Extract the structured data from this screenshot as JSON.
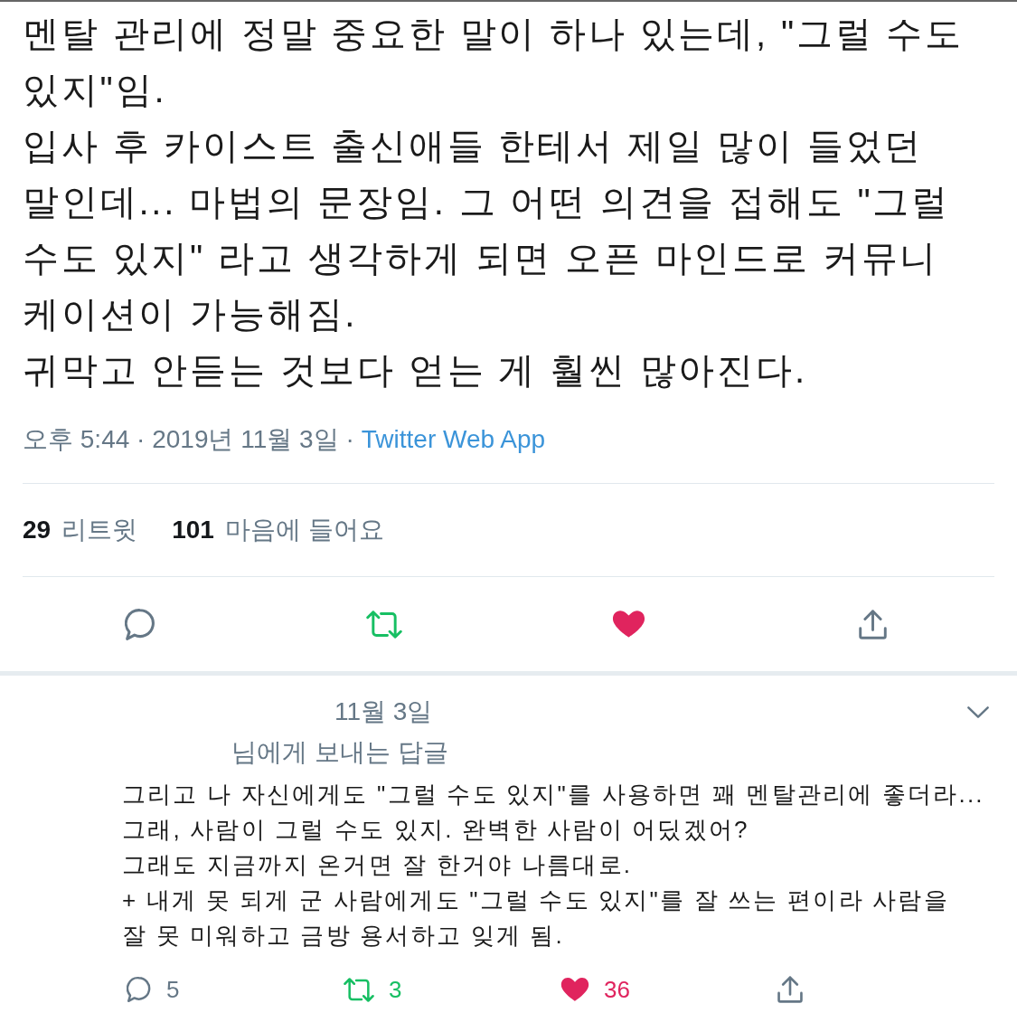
{
  "tweet": {
    "text": "멘탈 관리에 정말 중요한 말이 하나 있는데, \"그럴 수도\n있지\"임.\n입사 후 카이스트 출신애들 한테서 제일 많이 들었던\n말인데... 마법의 문장임. 그 어떤 의견을 접해도 \"그럴\n수도 있지\" 라고 생각하게 되면 오픈 마인드로 커뮤니\n케이션이 가능해짐.\n귀막고 안듣는 것보다 얻는 게 훨씬 많아진다.",
    "timestamp": "오후 5:44 · 2019년 11월 3일 ·",
    "source": "Twitter Web App",
    "stats": [
      {
        "count": "29",
        "label": "리트윗"
      },
      {
        "count": "101",
        "label": "마음에 들어요"
      }
    ],
    "actions": [
      {
        "kind": "reply",
        "on": false
      },
      {
        "kind": "retweet",
        "on": true
      },
      {
        "kind": "like",
        "on": true
      },
      {
        "kind": "share",
        "on": false
      }
    ]
  },
  "reply": {
    "date": "11월 3일",
    "replying_to": "님에게 보내는 답글",
    "text": "그리고 나 자신에게도 \"그럴 수도 있지\"를 사용하면 꽤 멘탈관리에 좋더라...\n그래, 사람이 그럴 수도 있지. 완벽한 사람이 어딨겠어?\n그래도 지금까지 온거면 잘 한거야 나름대로.\n+ 내게 못 되게 군 사람에게도 \"그럴 수도 있지\"를 잘 쓰는 편이라 사람을\n잘 못 미워하고 금방 용서하고 잊게 됨.",
    "actions": [
      {
        "kind": "reply",
        "count": "5",
        "on": false
      },
      {
        "kind": "retweet",
        "count": "3",
        "on": true
      },
      {
        "kind": "like",
        "count": "36",
        "on": true
      },
      {
        "kind": "share",
        "on": false
      }
    ]
  }
}
